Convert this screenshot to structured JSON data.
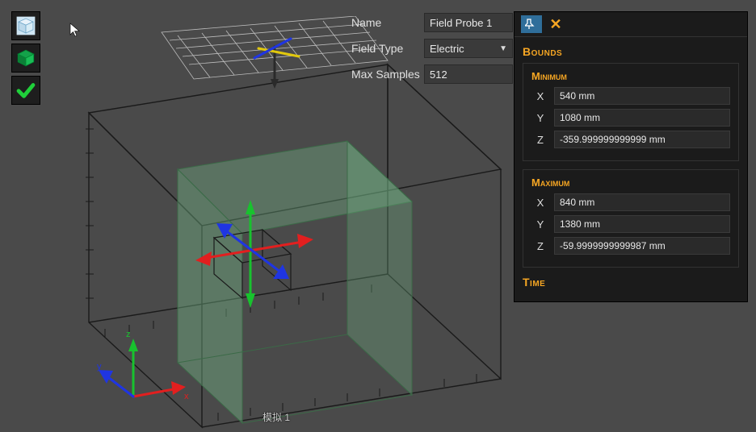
{
  "toolbar": {
    "items": [
      {
        "name": "view-cube-tool"
      },
      {
        "name": "box-tool"
      },
      {
        "name": "confirm-tool"
      }
    ]
  },
  "props": {
    "name_label": "Name",
    "name_value": "Field Probe 1",
    "field_type_label": "Field Type",
    "field_type_value": "Electric",
    "max_samples_label": "Max Samples",
    "max_samples_value": "512"
  },
  "bounds_panel": {
    "title": "Bounds",
    "min_title": "Minimum",
    "max_title": "Maximum",
    "time_title": "Time",
    "axes": {
      "x": "X",
      "y": "Y",
      "z": "Z"
    },
    "min": {
      "x": "540 mm",
      "y": "1080 mm",
      "z": "-359.999999999999 mm"
    },
    "max": {
      "x": "840 mm",
      "y": "1380 mm",
      "z": "-59.9999999999987 mm"
    }
  },
  "viewport": {
    "label": "模拟 1",
    "axis_labels": {
      "x": "x",
      "y": "y",
      "z": "z"
    }
  }
}
